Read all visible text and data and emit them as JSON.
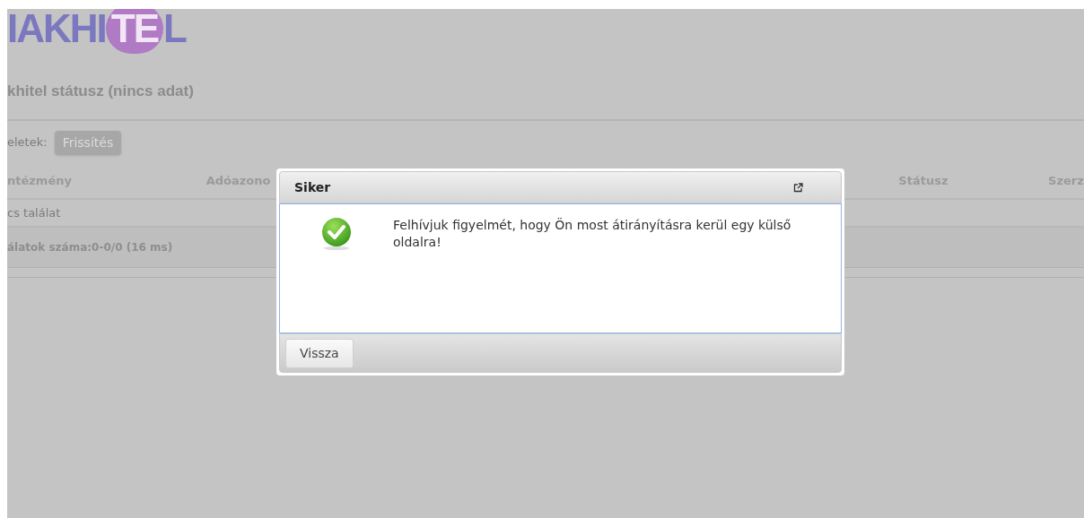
{
  "logo": {
    "text": "IAKHITEL"
  },
  "page_title": "khitel státusz (nincs adat)",
  "toolbar": {
    "label": "eletek:",
    "button": "Frissítés"
  },
  "table": {
    "columns": [
      "ntézmény",
      "Adóazono",
      "Státusz",
      "Szerz"
    ],
    "empty_message": "cs találat",
    "footer": "álatok száma:0-0/0 (16 ms)"
  },
  "dialog": {
    "title": "Siker",
    "kind": "success",
    "message": "Felhívjuk figyelmét, hogy Ön most átirányításra kerül egy külső oldalra!",
    "buttons": [
      "Vissza"
    ]
  }
}
